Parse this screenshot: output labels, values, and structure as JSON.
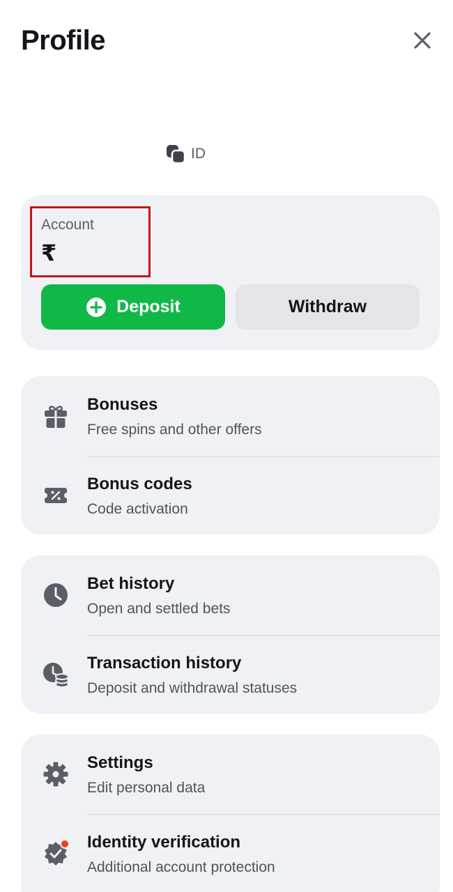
{
  "header": {
    "title": "Profile",
    "close_icon": "close-icon"
  },
  "profile": {
    "id_label": "ID",
    "copy_icon": "copy-icon"
  },
  "account": {
    "label": "Account",
    "balance": "₹",
    "deposit_label": "Deposit",
    "withdraw_label": "Withdraw",
    "deposit_color": "#10b947"
  },
  "menu": {
    "bonuses": {
      "title": "Bonuses",
      "subtitle": "Free spins and other offers",
      "icon": "gift-icon"
    },
    "bonus_codes": {
      "title": "Bonus codes",
      "subtitle": "Code activation",
      "icon": "coupon-icon"
    },
    "bet_history": {
      "title": "Bet history",
      "subtitle": "Open and settled bets",
      "icon": "clock-icon"
    },
    "transaction_history": {
      "title": "Transaction history",
      "subtitle": "Deposit and withdrawal statuses",
      "icon": "clock-coins-icon"
    },
    "settings": {
      "title": "Settings",
      "subtitle": "Edit personal data",
      "icon": "gear-icon"
    },
    "identity_verification": {
      "title": "Identity verification",
      "subtitle": "Additional account protection",
      "icon": "verified-badge-icon"
    }
  },
  "colors": {
    "highlight": "#c4161c",
    "notification_dot": "#e8450f",
    "card_bg": "#f0f1f4"
  }
}
